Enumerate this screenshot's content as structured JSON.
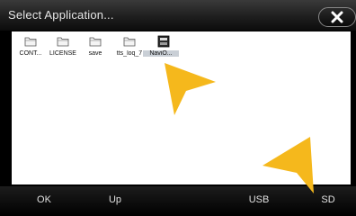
{
  "window": {
    "title": "Select Application..."
  },
  "files": [
    {
      "name": "CONT...",
      "type": "folder",
      "selected": false
    },
    {
      "name": "LICENSE",
      "type": "folder",
      "selected": false
    },
    {
      "name": "save",
      "type": "folder",
      "selected": false
    },
    {
      "name": "tts_loq_7",
      "type": "folder",
      "selected": false
    },
    {
      "name": "NaviO...",
      "type": "application",
      "selected": true
    }
  ],
  "bottom_nav": {
    "ok_label": "OK",
    "up_label": "Up",
    "usb_label": "USB",
    "sd_label": "SD"
  },
  "colors": {
    "pointer": "#f5b81c",
    "file_area": "#ffffff",
    "bar": "#000000"
  }
}
